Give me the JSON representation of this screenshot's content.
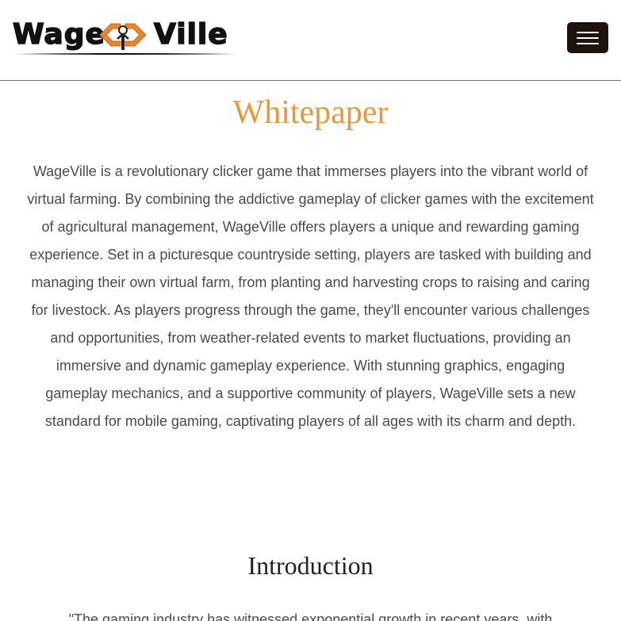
{
  "header": {
    "logo": {
      "text_left": "Wage",
      "text_right": "Ville",
      "icon": "farm-house-logo-icon"
    },
    "menu_icon": "hamburger-menu-icon"
  },
  "main": {
    "title": "Whitepaper",
    "intro": "WageVille is a revolutionary clicker game that immerses players into the vibrant world of virtual farming. By combining the addictive gameplay of clicker games with the excitement of agricultural management, WageVille offers players a unique and rewarding gaming experience. Set in a picturesque countryside setting, players are tasked with building and managing their own virtual farm, from planting and harvesting crops to raising and caring for livestock. As players progress through the game, they'll encounter various challenges and opportunities, from weather-related events to market fluctuations, providing an immersive and dynamic gameplay experience. With stunning graphics, engaging gameplay mechanics, and a supportive community of players, WageVille sets a new standard for mobile gaming, captivating players of all ages with its charm and depth.",
    "section_title": "Introduction",
    "section_text": "\"The gaming industry has witnessed exponential growth in recent years, with"
  },
  "colors": {
    "title": "#e29a3e",
    "menu_button": "#1e130c",
    "header_border": "#8a7a3a",
    "body_text": "#4a4a4a",
    "logo_orange": "#e8862f"
  }
}
